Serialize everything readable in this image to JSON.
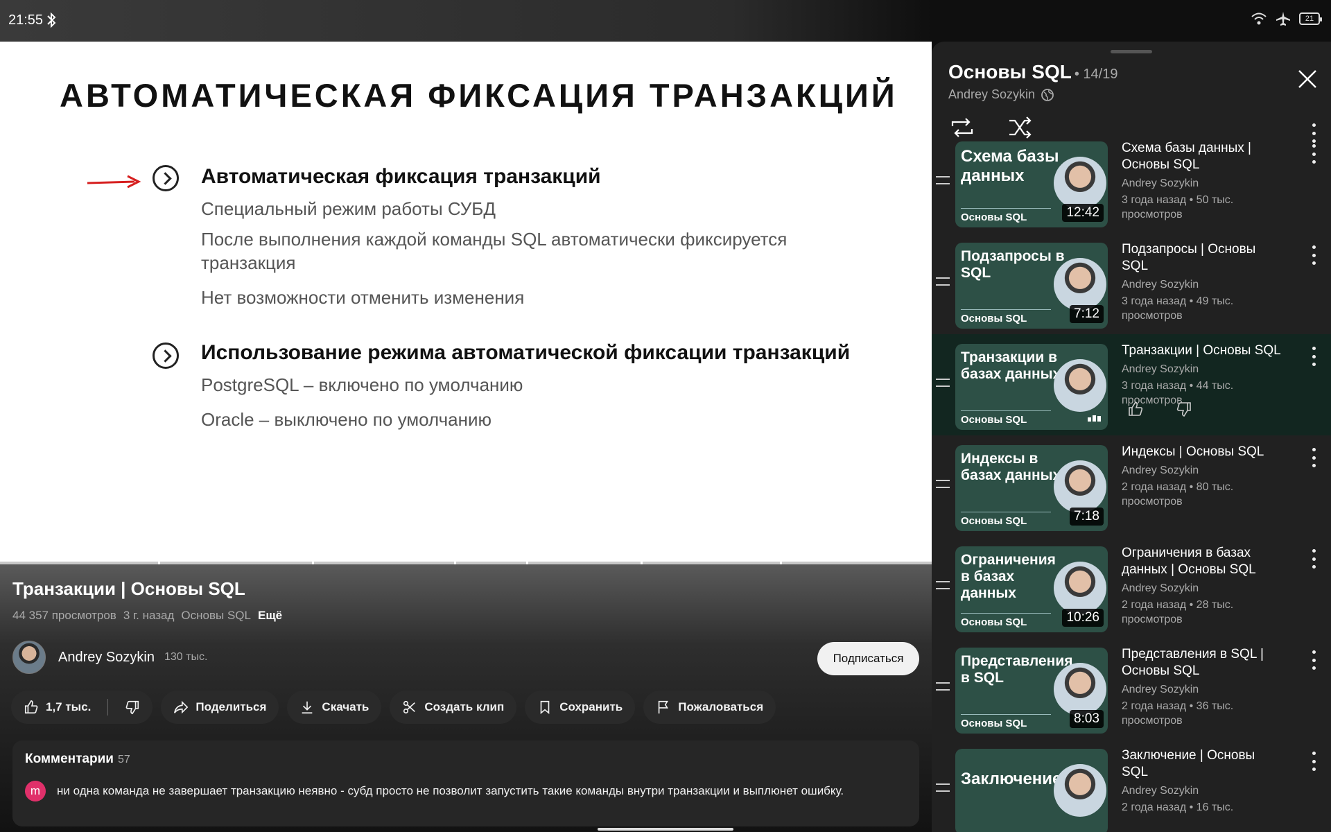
{
  "status_bar": {
    "time": "21:55",
    "battery": "21"
  },
  "slide": {
    "title": "АВТОМАТИЧЕСКАЯ ФИКСАЦИЯ ТРАНЗАКЦИЙ",
    "section1": {
      "heading": "Автоматическая фиксация транзакций",
      "lines": [
        "Специальный режим работы СУБД",
        "После выполнения каждой команды SQL автоматически фиксируется транзакция",
        "Нет возможности отменить изменения"
      ]
    },
    "section2": {
      "heading": "Использование режима автоматической фиксации транзакций",
      "lines": [
        "PostgreSQL – включено по умолчанию",
        "Oracle – выключено по умолчанию"
      ]
    }
  },
  "video": {
    "title": "Транзакции | Основы SQL",
    "views": "44 357 просмотров",
    "age": "3 г. назад",
    "playlist_tag": "Основы SQL",
    "more": "Ещё",
    "channel": "Andrey Sozykin",
    "subscribers": "130 тыс.",
    "subscribe_label": "Подписаться",
    "progress": 1.0
  },
  "actions": {
    "likes": "1,7 тыс.",
    "share": "Поделиться",
    "download": "Скачать",
    "clip": "Создать клип",
    "save": "Сохранить",
    "report": "Пожаловаться"
  },
  "comments": {
    "label": "Комментарии",
    "count": "57",
    "top_avatar": "m",
    "top_text": "ни одна команда не завершает транзакцию неявно - субд просто не позволит запустить такие команды внутри транзакции и выплюнет ошибку."
  },
  "playlist": {
    "title": "Основы SQL",
    "position": "• 14/19",
    "author": "Andrey Sozykin",
    "items": [
      {
        "thumb_text": "Схема базы данных",
        "series": "Основы SQL",
        "duration": "12:42",
        "title": "Схема базы данных | Основы SQL",
        "author": "Andrey Sozykin",
        "stats": "3 года назад • 50 тыс. просмотров"
      },
      {
        "thumb_text": "Подзапросы в SQL",
        "series": "Основы SQL",
        "duration": "7:12",
        "title": "Подзапросы | Основы SQL",
        "author": "Andrey Sozykin",
        "stats": "3 года назад • 49 тыс. просмотров"
      },
      {
        "thumb_text": "Транзакции в базах данных",
        "series": "Основы SQL",
        "duration": "",
        "title": "Транзакции | Основы SQL",
        "author": "Andrey Sozykin",
        "stats": "3 года назад • 44 тыс. просмотров",
        "current": true
      },
      {
        "thumb_text": "Индексы в базах данных",
        "series": "Основы SQL",
        "duration": "7:18",
        "title": "Индексы | Основы SQL",
        "author": "Andrey Sozykin",
        "stats": "2 года назад • 80 тыс. просмотров"
      },
      {
        "thumb_text": "Ограничения в базах данных",
        "series": "Основы SQL",
        "duration": "10:26",
        "title": "Ограничения в базах данных | Основы SQL",
        "author": "Andrey Sozykin",
        "stats": "2 года назад • 28 тыс. просмотров"
      },
      {
        "thumb_text": "Представления в SQL",
        "series": "Основы SQL",
        "duration": "8:03",
        "title": "Представления в SQL | Основы SQL",
        "author": "Andrey Sozykin",
        "stats": "2 года назад • 36 тыс. просмотров"
      },
      {
        "thumb_text": "Заключение",
        "series": "",
        "duration": "",
        "title": "Заключение | Основы SQL",
        "author": "Andrey Sozykin",
        "stats": "2 года назад • 16 тыс."
      }
    ]
  },
  "colors": {
    "accent_current": "#122620",
    "thumb_bg": "#2d5046",
    "comment_avatar": "#e0306a",
    "arrow": "#d61f1f"
  }
}
